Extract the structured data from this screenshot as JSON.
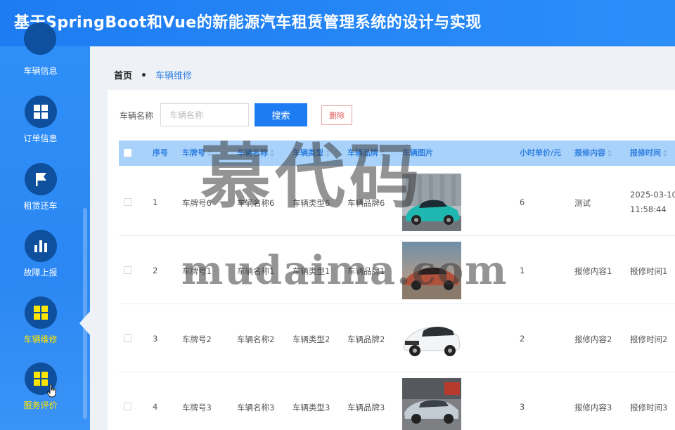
{
  "app": {
    "title": "基于SpringBoot和Vue的新能源汽车租赁管理系统的设计与实现"
  },
  "sidebar": {
    "items": [
      {
        "label": "车辆信息",
        "icon": "circle-icon"
      },
      {
        "label": "订单信息",
        "icon": "grid-icon"
      },
      {
        "label": "租赁还车",
        "icon": "flag-icon"
      },
      {
        "label": "故障上报",
        "icon": "bar-chart-icon"
      },
      {
        "label": "车辆维修",
        "icon": "grid-icon",
        "active": true
      },
      {
        "label": "服务评价",
        "icon": "grid-icon",
        "hover": true
      }
    ],
    "active_color": "#ffe600"
  },
  "breadcrumb": {
    "home": "首页",
    "current": "车辆维修"
  },
  "search": {
    "label": "车辆名称",
    "placeholder": "车辆名称",
    "button": "搜索",
    "delete_button": "删除"
  },
  "table": {
    "headers": [
      "序号",
      "车牌号",
      "车辆名称",
      "车辆类型",
      "车辆品牌",
      "车辆图片",
      "小时单价/元",
      "报修内容",
      "报修时间"
    ],
    "rows": [
      {
        "index": "1",
        "plate": "车牌号6",
        "name": "车辆名称6",
        "type": "车辆类型6",
        "brand": "车辆品牌6",
        "image": "teal-car",
        "price": "6",
        "content": "测试",
        "time": "2025-03-10",
        "time2": "11:58:44"
      },
      {
        "index": "2",
        "plate": "车牌号1",
        "name": "车辆名称1",
        "type": "车辆类型1",
        "brand": "车辆品牌1",
        "image": "red-car",
        "price": "1",
        "content": "报修内容1",
        "time": "报修时间1",
        "time2": ""
      },
      {
        "index": "3",
        "plate": "车牌号2",
        "name": "车辆名称2",
        "type": "车辆类型2",
        "brand": "车辆品牌2",
        "image": "white-car",
        "price": "2",
        "content": "报修内容2",
        "time": "报修时间2",
        "time2": ""
      },
      {
        "index": "4",
        "plate": "车牌号3",
        "name": "车辆名称3",
        "type": "车辆类型3",
        "brand": "车辆品牌3",
        "image": "silver-car",
        "price": "3",
        "content": "报修内容3",
        "time": "报修时间3",
        "time2": ""
      }
    ]
  },
  "watermark": {
    "line1": "慕代码",
    "line2": "mudaima.com"
  },
  "colors": {
    "primary": "#1e7cf2",
    "header_bg": "#a9d2fb",
    "danger": "#e05a5a"
  }
}
